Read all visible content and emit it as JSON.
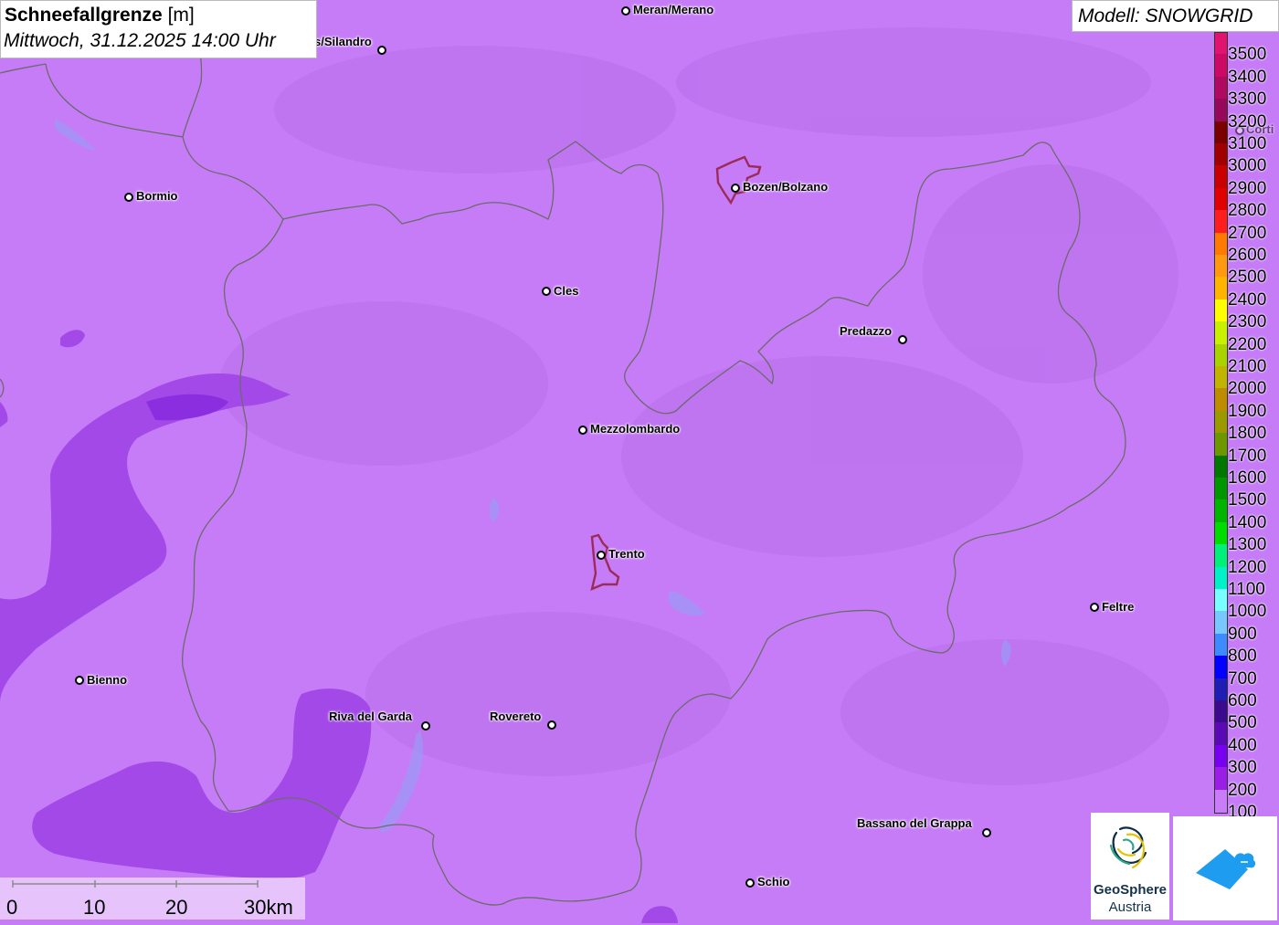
{
  "title": {
    "parameter": "Schneefallgrenze",
    "unit": "[m]",
    "datetime": "Mittwoch, 31.12.2025 14:00 Uhr"
  },
  "model_label": "Modell: SNOWGRID",
  "colors": {
    "background_fill": "#c77cf7",
    "low_fill": "#a349e8",
    "lowest_fill": "#8a2ee0",
    "border_line": "#6b6b6b",
    "city_outline": "#9b2c5a"
  },
  "cities": [
    {
      "name": "Meran/Merano"
    },
    {
      "name": "s/Silandro"
    },
    {
      "name": "Bozen/Bolzano"
    },
    {
      "name": "Bormio"
    },
    {
      "name": "Cles"
    },
    {
      "name": "Predazzo"
    },
    {
      "name": "Mezzolombardo"
    },
    {
      "name": "Trento"
    },
    {
      "name": "Feltre"
    },
    {
      "name": "Bienno"
    },
    {
      "name": "Riva del Garda"
    },
    {
      "name": "Rovereto"
    },
    {
      "name": "Bassano del Grappa"
    },
    {
      "name": "Schio"
    },
    {
      "name": "Corti"
    }
  ],
  "legend": {
    "items": [
      {
        "label": "3500",
        "color": "#e0146e"
      },
      {
        "label": "3400",
        "color": "#cc0a66"
      },
      {
        "label": "3300",
        "color": "#b00a60"
      },
      {
        "label": "3200",
        "color": "#96085a"
      },
      {
        "label": "3100",
        "color": "#7a0000"
      },
      {
        "label": "3000",
        "color": "#a00000"
      },
      {
        "label": "2900",
        "color": "#c80000"
      },
      {
        "label": "2800",
        "color": "#e00000"
      },
      {
        "label": "2700",
        "color": "#ff1e1e"
      },
      {
        "label": "2600",
        "color": "#ff7a00"
      },
      {
        "label": "2500",
        "color": "#ff9a10"
      },
      {
        "label": "2400",
        "color": "#ffb400"
      },
      {
        "label": "2300",
        "color": "#ffff00"
      },
      {
        "label": "2200",
        "color": "#c8f000"
      },
      {
        "label": "2100",
        "color": "#a8d200"
      },
      {
        "label": "2000",
        "color": "#c0b400"
      },
      {
        "label": "1900",
        "color": "#be8c00"
      },
      {
        "label": "1800",
        "color": "#9a9a00"
      },
      {
        "label": "1700",
        "color": "#6e9600"
      },
      {
        "label": "1600",
        "color": "#007800"
      },
      {
        "label": "1500",
        "color": "#009600"
      },
      {
        "label": "1400",
        "color": "#00b400"
      },
      {
        "label": "1300",
        "color": "#00dc00"
      },
      {
        "label": "1200",
        "color": "#00f07a"
      },
      {
        "label": "1100",
        "color": "#00f0c8"
      },
      {
        "label": "1000",
        "color": "#78ffff"
      },
      {
        "label": "900",
        "color": "#78c8ff"
      },
      {
        "label": "800",
        "color": "#3c8cff"
      },
      {
        "label": "700",
        "color": "#0000ff"
      },
      {
        "label": "600",
        "color": "#1e1eb4"
      },
      {
        "label": "500",
        "color": "#3c0a8c"
      },
      {
        "label": "400",
        "color": "#5a0ab4"
      },
      {
        "label": "300",
        "color": "#7800f0"
      },
      {
        "label": "200",
        "color": "#9a1ee6"
      },
      {
        "label": "100",
        "color": "#c87cf7"
      }
    ]
  },
  "scale": {
    "labels": [
      "0",
      "10",
      "20",
      "30km"
    ]
  },
  "logos": {
    "geosphere_name": "GeoSphere",
    "geosphere_sub": "Austria"
  }
}
